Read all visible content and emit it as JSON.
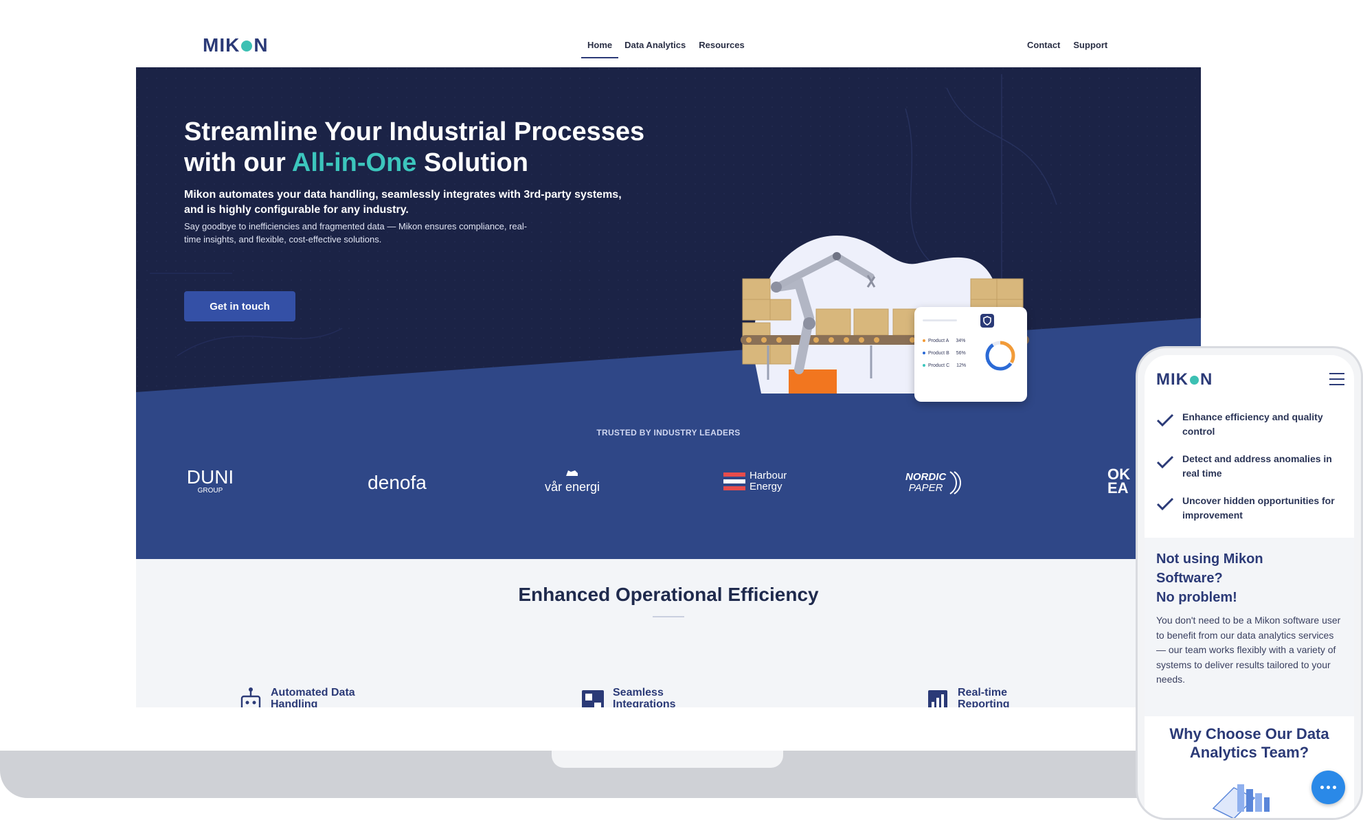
{
  "desktop": {
    "logo": {
      "left": "MIK",
      "right": "N"
    },
    "nav": {
      "links": [
        "Home",
        "Data Analytics",
        "Resources"
      ],
      "right_links": [
        "Contact",
        "Support"
      ]
    },
    "hero": {
      "title_line1": "Streamline Your Industrial Processes",
      "title_line2_pre": "with our ",
      "title_accent": "All-in-One",
      "title_line2_post": " Solution",
      "subtitle": "Mikon automates your data handling, seamlessly integrates with 3rd-party systems, and is highly configurable for any industry.",
      "description": "Say goodbye to inefficiencies and fragmented data — Mikon ensures compliance, real-time insights, and flexible, cost-effective solutions.",
      "cta": "Get in touch",
      "card": {
        "rows": [
          {
            "label": "Product A",
            "value": "34%"
          },
          {
            "label": "Product B",
            "value": "56%"
          },
          {
            "label": "Product C",
            "value": "12%"
          }
        ]
      }
    },
    "trusted": {
      "heading": "TRUSTED BY INDUSTRY LEADERS",
      "brands": [
        {
          "line1": "DUNI",
          "line2": "GROUP"
        },
        {
          "line1": "denofa"
        },
        {
          "line1": "vår energi"
        },
        {
          "line1": "Harbour",
          "line2": "Energy"
        },
        {
          "line1": "NORDIC",
          "line2": "PAPER"
        },
        {
          "line1": "OK",
          "line2": "EA"
        }
      ]
    },
    "efficiency": {
      "title": "Enhanced Operational Efficiency",
      "features": [
        "Automated Data Handling",
        "Seamless Integrations",
        "Real-time Reporting"
      ]
    }
  },
  "mobile": {
    "logo": {
      "left": "MIK",
      "right": "N"
    },
    "checks": [
      "Enhance efficiency and quality control",
      "Detect and address anomalies in real time",
      "Uncover hidden opportunities for improvement"
    ],
    "np_title_1": "Not using Mikon Software?",
    "np_title_2": "No problem!",
    "np_desc": "You don't need to be a Mikon software user to benefit from our data analytics services — our team works flexibly with a variety of systems to deliver results tailored to your needs.",
    "why_title": "Why Choose Our Data Analytics Team?"
  },
  "colors": {
    "navy": "#1b2346",
    "blue": "#2f4787",
    "accent": "#3cc6bd",
    "button": "#3450a6",
    "chat": "#2a89e8"
  }
}
